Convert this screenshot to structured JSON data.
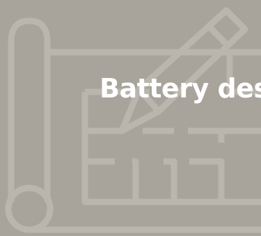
{
  "tile": {
    "title": "Battery design",
    "background_color": "#a8a49b",
    "icon_color": "#b9b6ae",
    "title_color": "#ffffff",
    "icon": "blueprint-pencil-icon"
  }
}
